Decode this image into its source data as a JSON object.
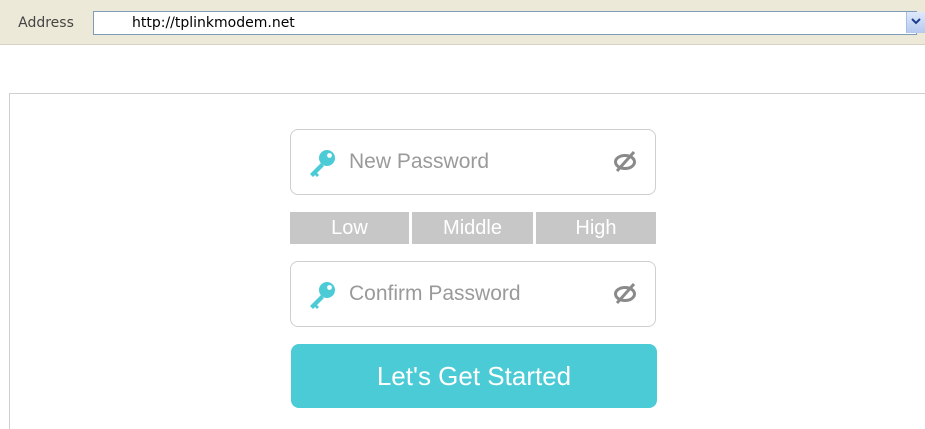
{
  "address_bar": {
    "label": "Address",
    "url": "http://tplinkmodem.net"
  },
  "form": {
    "new_password": {
      "placeholder": "New Password",
      "value": ""
    },
    "strength": {
      "low": "Low",
      "middle": "Middle",
      "high": "High"
    },
    "confirm_password": {
      "placeholder": "Confirm Password",
      "value": ""
    },
    "submit_label": "Let's Get Started"
  },
  "colors": {
    "accent": "#4acbd6",
    "strength_inactive": "#c7c7c7",
    "placeholder": "#9a9a9a"
  },
  "icons": {
    "field_icon": "key-icon",
    "toggle_icon": "eye-slash-icon",
    "dropdown_icon": "chevron-down-icon"
  }
}
